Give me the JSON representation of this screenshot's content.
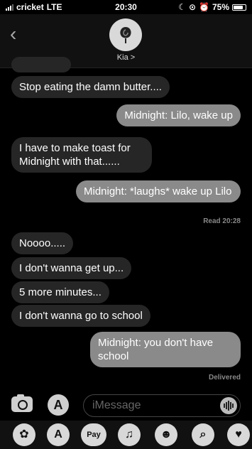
{
  "status": {
    "carrier": "cricket",
    "network": "LTE",
    "time": "20:30",
    "battery": "75%"
  },
  "header": {
    "contact_name": "Kia",
    "contact_chevron": ">"
  },
  "messages": [
    {
      "dir": "in",
      "text": "Stop eating the damn butter...."
    },
    {
      "dir": "out",
      "text": "Midnight: Lilo, wake up"
    },
    {
      "dir": "in",
      "text": "I have to make toast for Midnight with that......"
    },
    {
      "dir": "out",
      "text": "Midnight: *laughs* wake up Lilo"
    },
    {
      "dir": "in",
      "text": "Noooo....."
    },
    {
      "dir": "in",
      "text": "I don't wanna get up..."
    },
    {
      "dir": "in",
      "text": "5 more minutes..."
    },
    {
      "dir": "in",
      "text": "I don't wanna go to school"
    },
    {
      "dir": "out",
      "text": "Midnight: you don't have school"
    }
  ],
  "receipts": {
    "read": "Read 20:28",
    "delivered": "Delivered"
  },
  "compose": {
    "placeholder": "iMessage"
  },
  "drawer": {
    "apple_pay_label": "Pay"
  }
}
